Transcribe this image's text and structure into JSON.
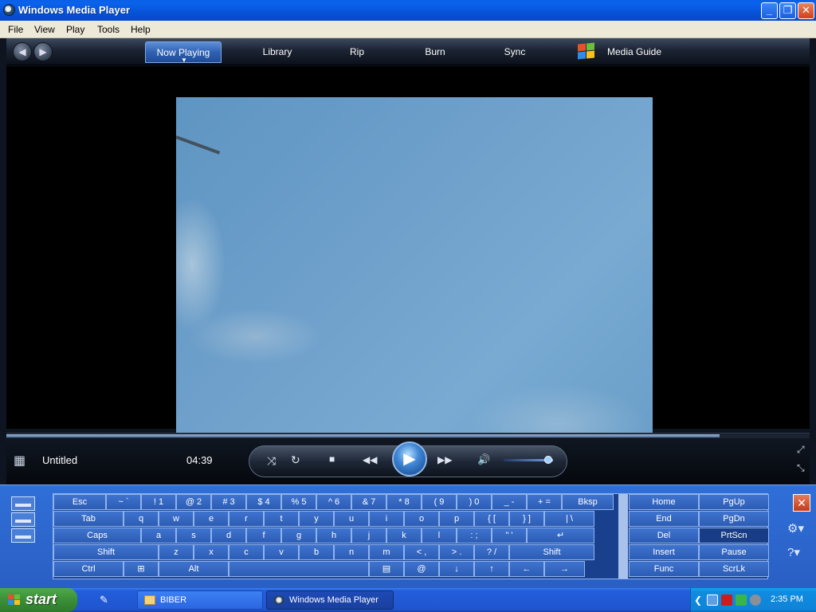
{
  "window": {
    "title": "Windows Media Player",
    "controls": {
      "minimize": "_",
      "maximize": "❐",
      "close": "✕"
    }
  },
  "menu": [
    "File",
    "View",
    "Play",
    "Tools",
    "Help"
  ],
  "tabs": {
    "now_playing": "Now Playing",
    "library": "Library",
    "rip": "Rip",
    "burn": "Burn",
    "sync": "Sync",
    "media_guide": "Media Guide"
  },
  "player": {
    "title": "Untitled",
    "time": "04:39",
    "seek_progress": 0.888,
    "volume": 0.9,
    "icons": {
      "shuffle": "⤨",
      "repeat": "↻",
      "stop": "■",
      "previous": "◀◀",
      "play": "▶",
      "next": "▶▶",
      "mute": "🔊",
      "fullscreen": "⤢",
      "compact": "⤡",
      "nowplaying_thumb": "▦"
    }
  },
  "keyboard": {
    "row1": [
      "Esc",
      "~ `",
      "! 1",
      "@ 2",
      "# 3",
      "$ 4",
      "% 5",
      "^ 6",
      "& 7",
      "* 8",
      "( 9",
      ") 0",
      "_ -",
      "+ =",
      "Bksp"
    ],
    "row2": [
      "Tab",
      "q",
      "w",
      "e",
      "r",
      "t",
      "y",
      "u",
      "i",
      "o",
      "p",
      "{ [",
      "} ]",
      "| \\"
    ],
    "row3": [
      "Caps",
      "a",
      "s",
      "d",
      "f",
      "g",
      "h",
      "j",
      "k",
      "l",
      ": ;",
      "\" '",
      "↵"
    ],
    "row4": [
      "Shift",
      "z",
      "x",
      "c",
      "v",
      "b",
      "n",
      "m",
      "< ,",
      "> .",
      "? /",
      "Shift"
    ],
    "row5": [
      "Ctrl",
      "⊞",
      "Alt",
      "",
      "▤",
      "@",
      "↓",
      "↑",
      "←",
      "→"
    ],
    "nav": [
      [
        "Home",
        "PgUp"
      ],
      [
        "End",
        "PgDn"
      ],
      [
        "Del",
        "PrtScn"
      ],
      [
        "Insert",
        "Pause"
      ],
      [
        "Func",
        "ScrLk"
      ]
    ],
    "close": "✕",
    "options_icon": "⚙▾",
    "help_icon": "?▾"
  },
  "taskbar": {
    "start": "start",
    "quick_launch_icon": "✎",
    "tasks": [
      "BIBER",
      "Windows Media Player"
    ],
    "clock": "2:35 PM",
    "tray_collapse": "❮"
  },
  "colors": {
    "xp_blue": "#0653d8",
    "osk_blue": "#2f6fd8",
    "start_green": "#3b8f37"
  }
}
